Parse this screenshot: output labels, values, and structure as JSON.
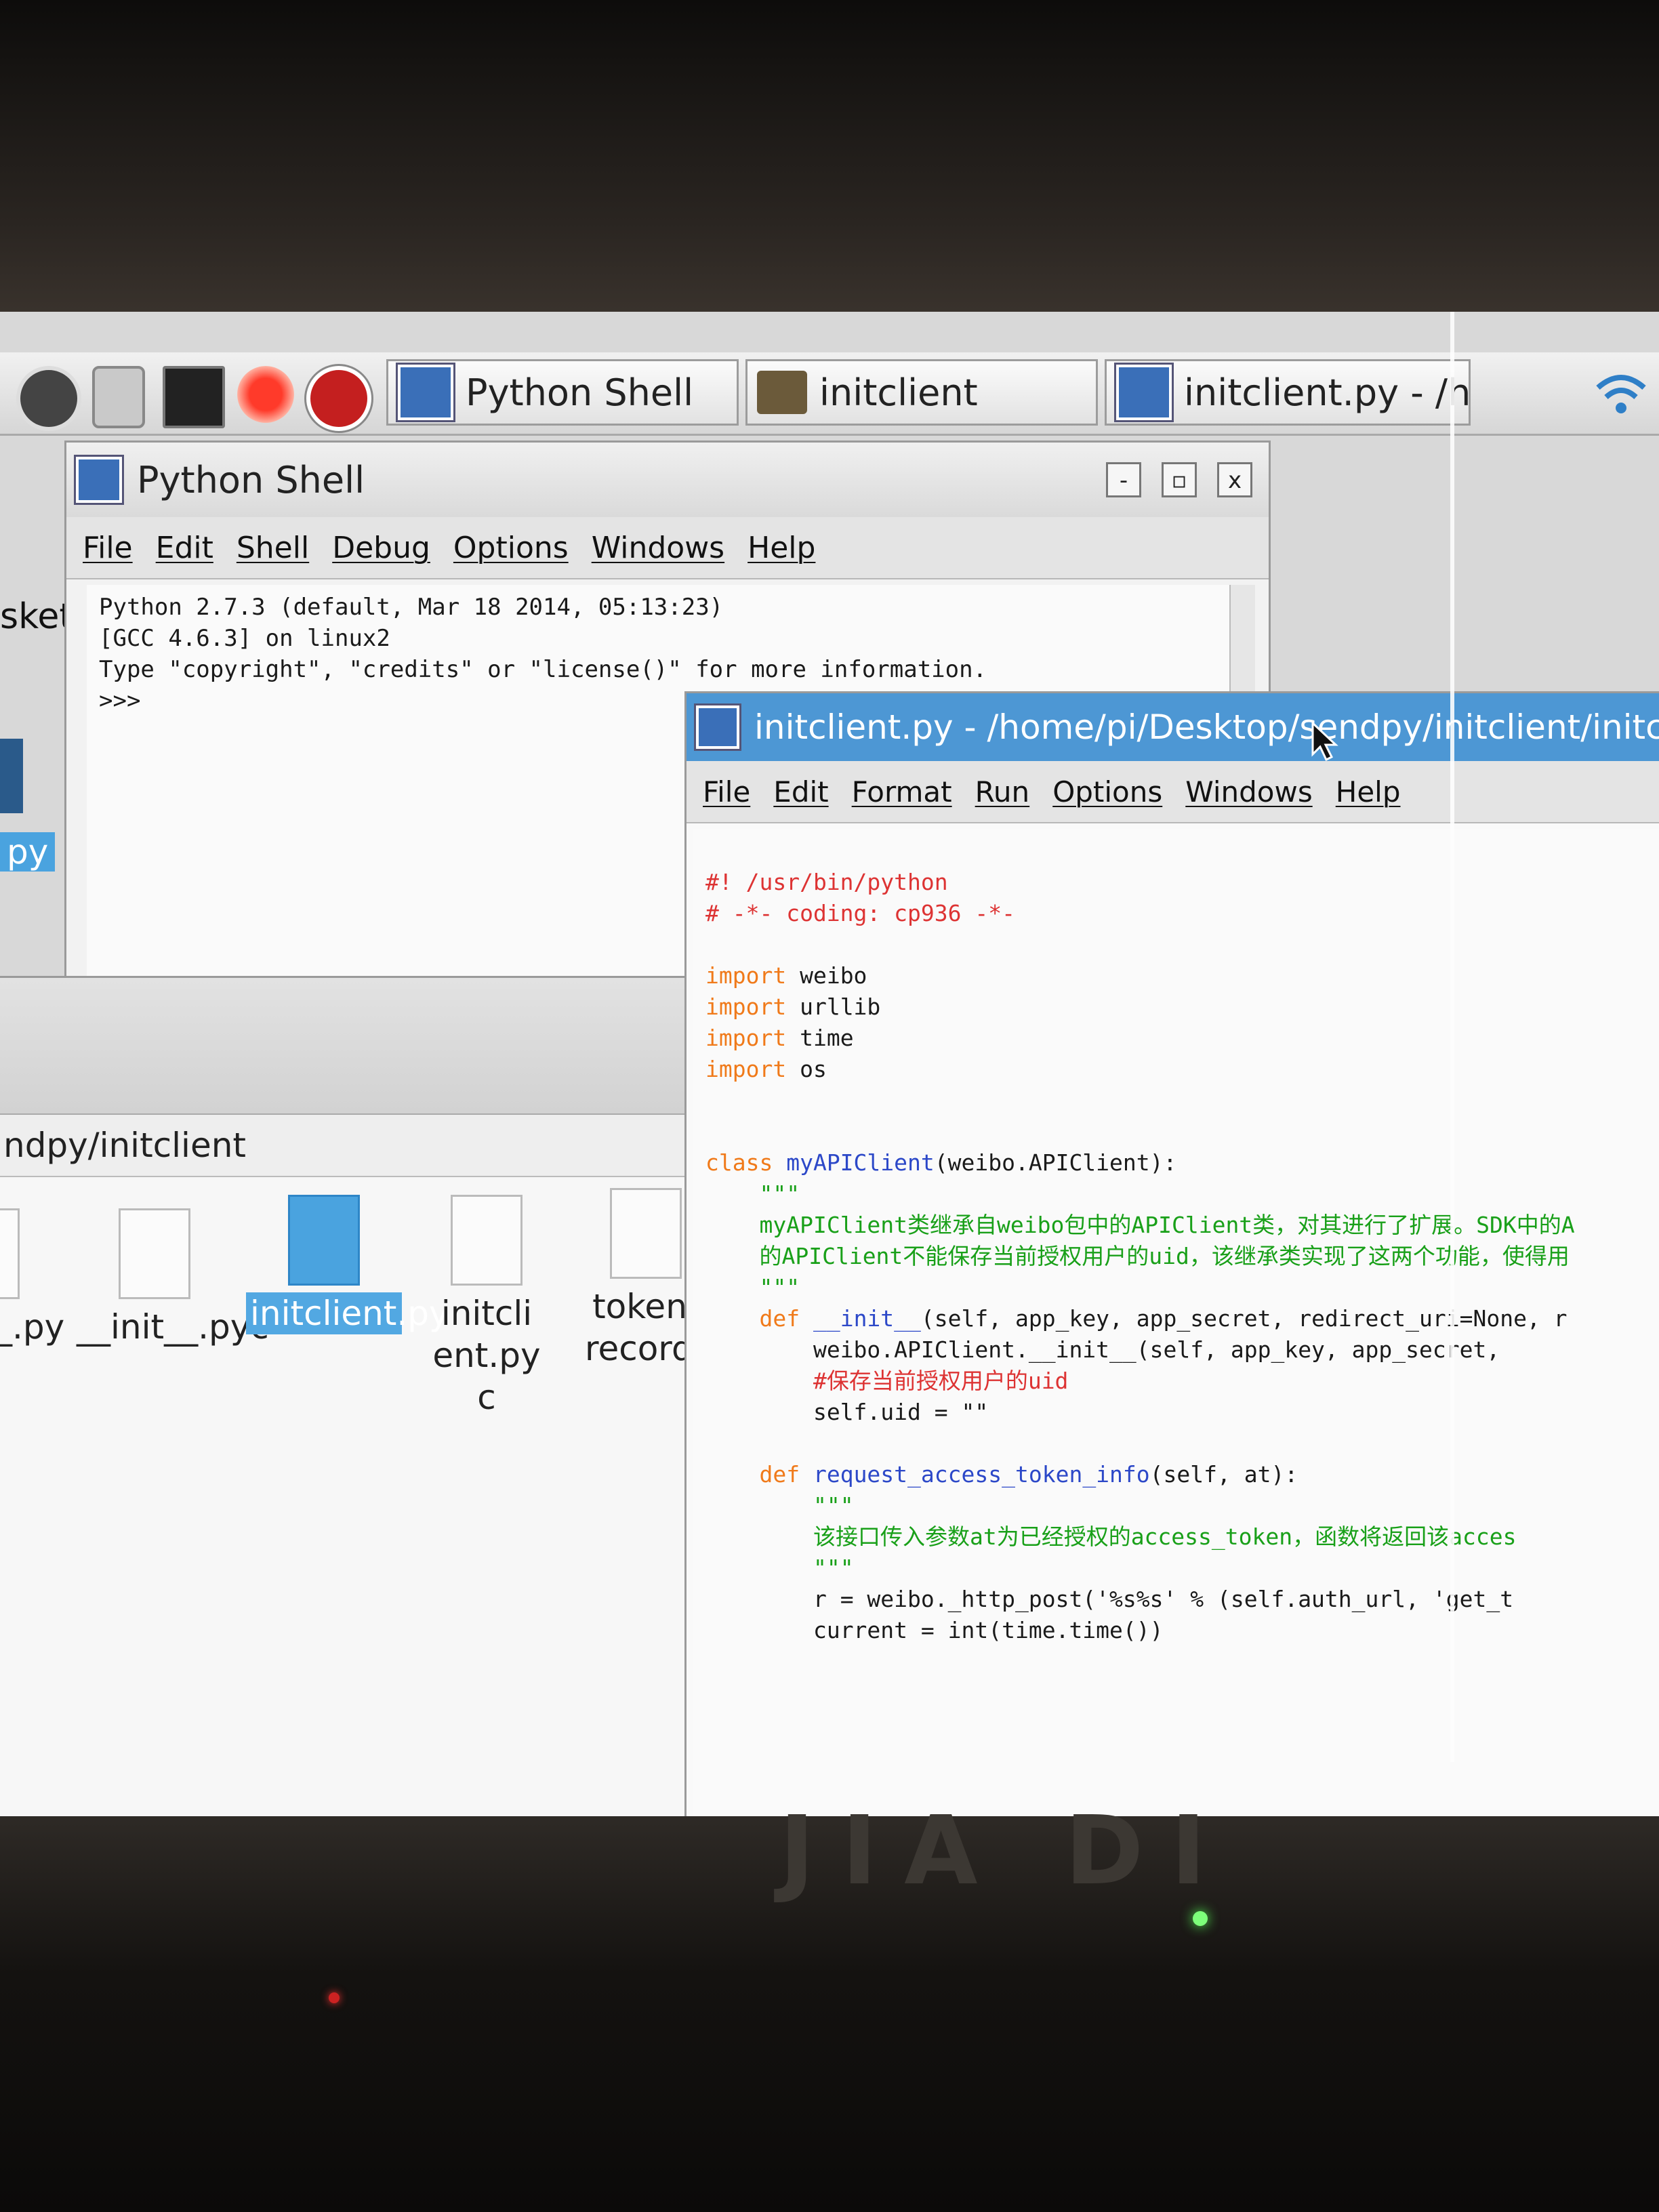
{
  "taskbar": {
    "tasks": [
      {
        "label": "Python Shell"
      },
      {
        "label": "initclient"
      },
      {
        "label": "initclient.py - /home/..."
      }
    ]
  },
  "desktop": {
    "icon_labels": [
      "sket",
      "py"
    ]
  },
  "shell_window": {
    "title": "Python Shell",
    "controls": {
      "minimize": "-",
      "maximize": "▫",
      "close": "x"
    },
    "menu": [
      "File",
      "Edit",
      "Shell",
      "Debug",
      "Options",
      "Windows",
      "Help"
    ],
    "lines": [
      "Python 2.7.3 (default, Mar 18 2014, 05:13:23)",
      "[GCC 4.6.3] on linux2",
      "Type \"copyright\", \"credits\" or \"license()\" for more information.",
      ">>>"
    ]
  },
  "file_manager": {
    "path": "ndpy/initclient",
    "items": [
      {
        "label": "_.py",
        "selected": false
      },
      {
        "label": "__init__.pyc",
        "selected": false
      },
      {
        "label": "initclient.py",
        "selected": true
      },
      {
        "label": "initclient.pyc",
        "selected": false
      },
      {
        "label": "token-record.log",
        "selected": false
      }
    ]
  },
  "editor_window": {
    "title": "initclient.py - /home/pi/Desktop/sendpy/initclient/initclient.py",
    "menu": [
      "File",
      "Edit",
      "Format",
      "Run",
      "Options",
      "Windows",
      "Help"
    ],
    "code": {
      "l1": "#! /usr/bin/python",
      "l2": "# -*- coding: cp936 -*-",
      "imp_kw": "import",
      "imp1": " weibo",
      "imp2": " urllib",
      "imp3": " time",
      "imp4": " os",
      "class_kw": "class",
      "class_name": " myAPIClient",
      "class_rest": "(weibo.APIClient):",
      "doc_q": "\"\"\"",
      "doc1": "myAPIClient类继承自weibo包中的APIClient类，对其进行了扩展。SDK中的A",
      "doc2": "的APIClient不能保存当前授权用户的uid，该继承类实现了这两个功能，使得用",
      "def_kw": "def",
      "def1_name": " __init__",
      "def1_rest": "(self, app_key, app_secret, redirect_uri=None, r",
      "init_call": "weibo.APIClient.__init__(self, app_key, app_secret,",
      "uid_comment": "#保存当前授权用户的uid",
      "uid_assign": "self.uid = \"\"",
      "def2_name": " request_access_token_info",
      "def2_rest": "(self, at):",
      "doc3": "该接口传入参数at为已经授权的access_token，函数将返回该acces",
      "post_line": "r = weibo._http_post('%s%s' % (self.auth_url, 'get_t",
      "time_line": "current = int(time.time())"
    }
  },
  "monitor": {
    "brand": "JIA DI"
  }
}
